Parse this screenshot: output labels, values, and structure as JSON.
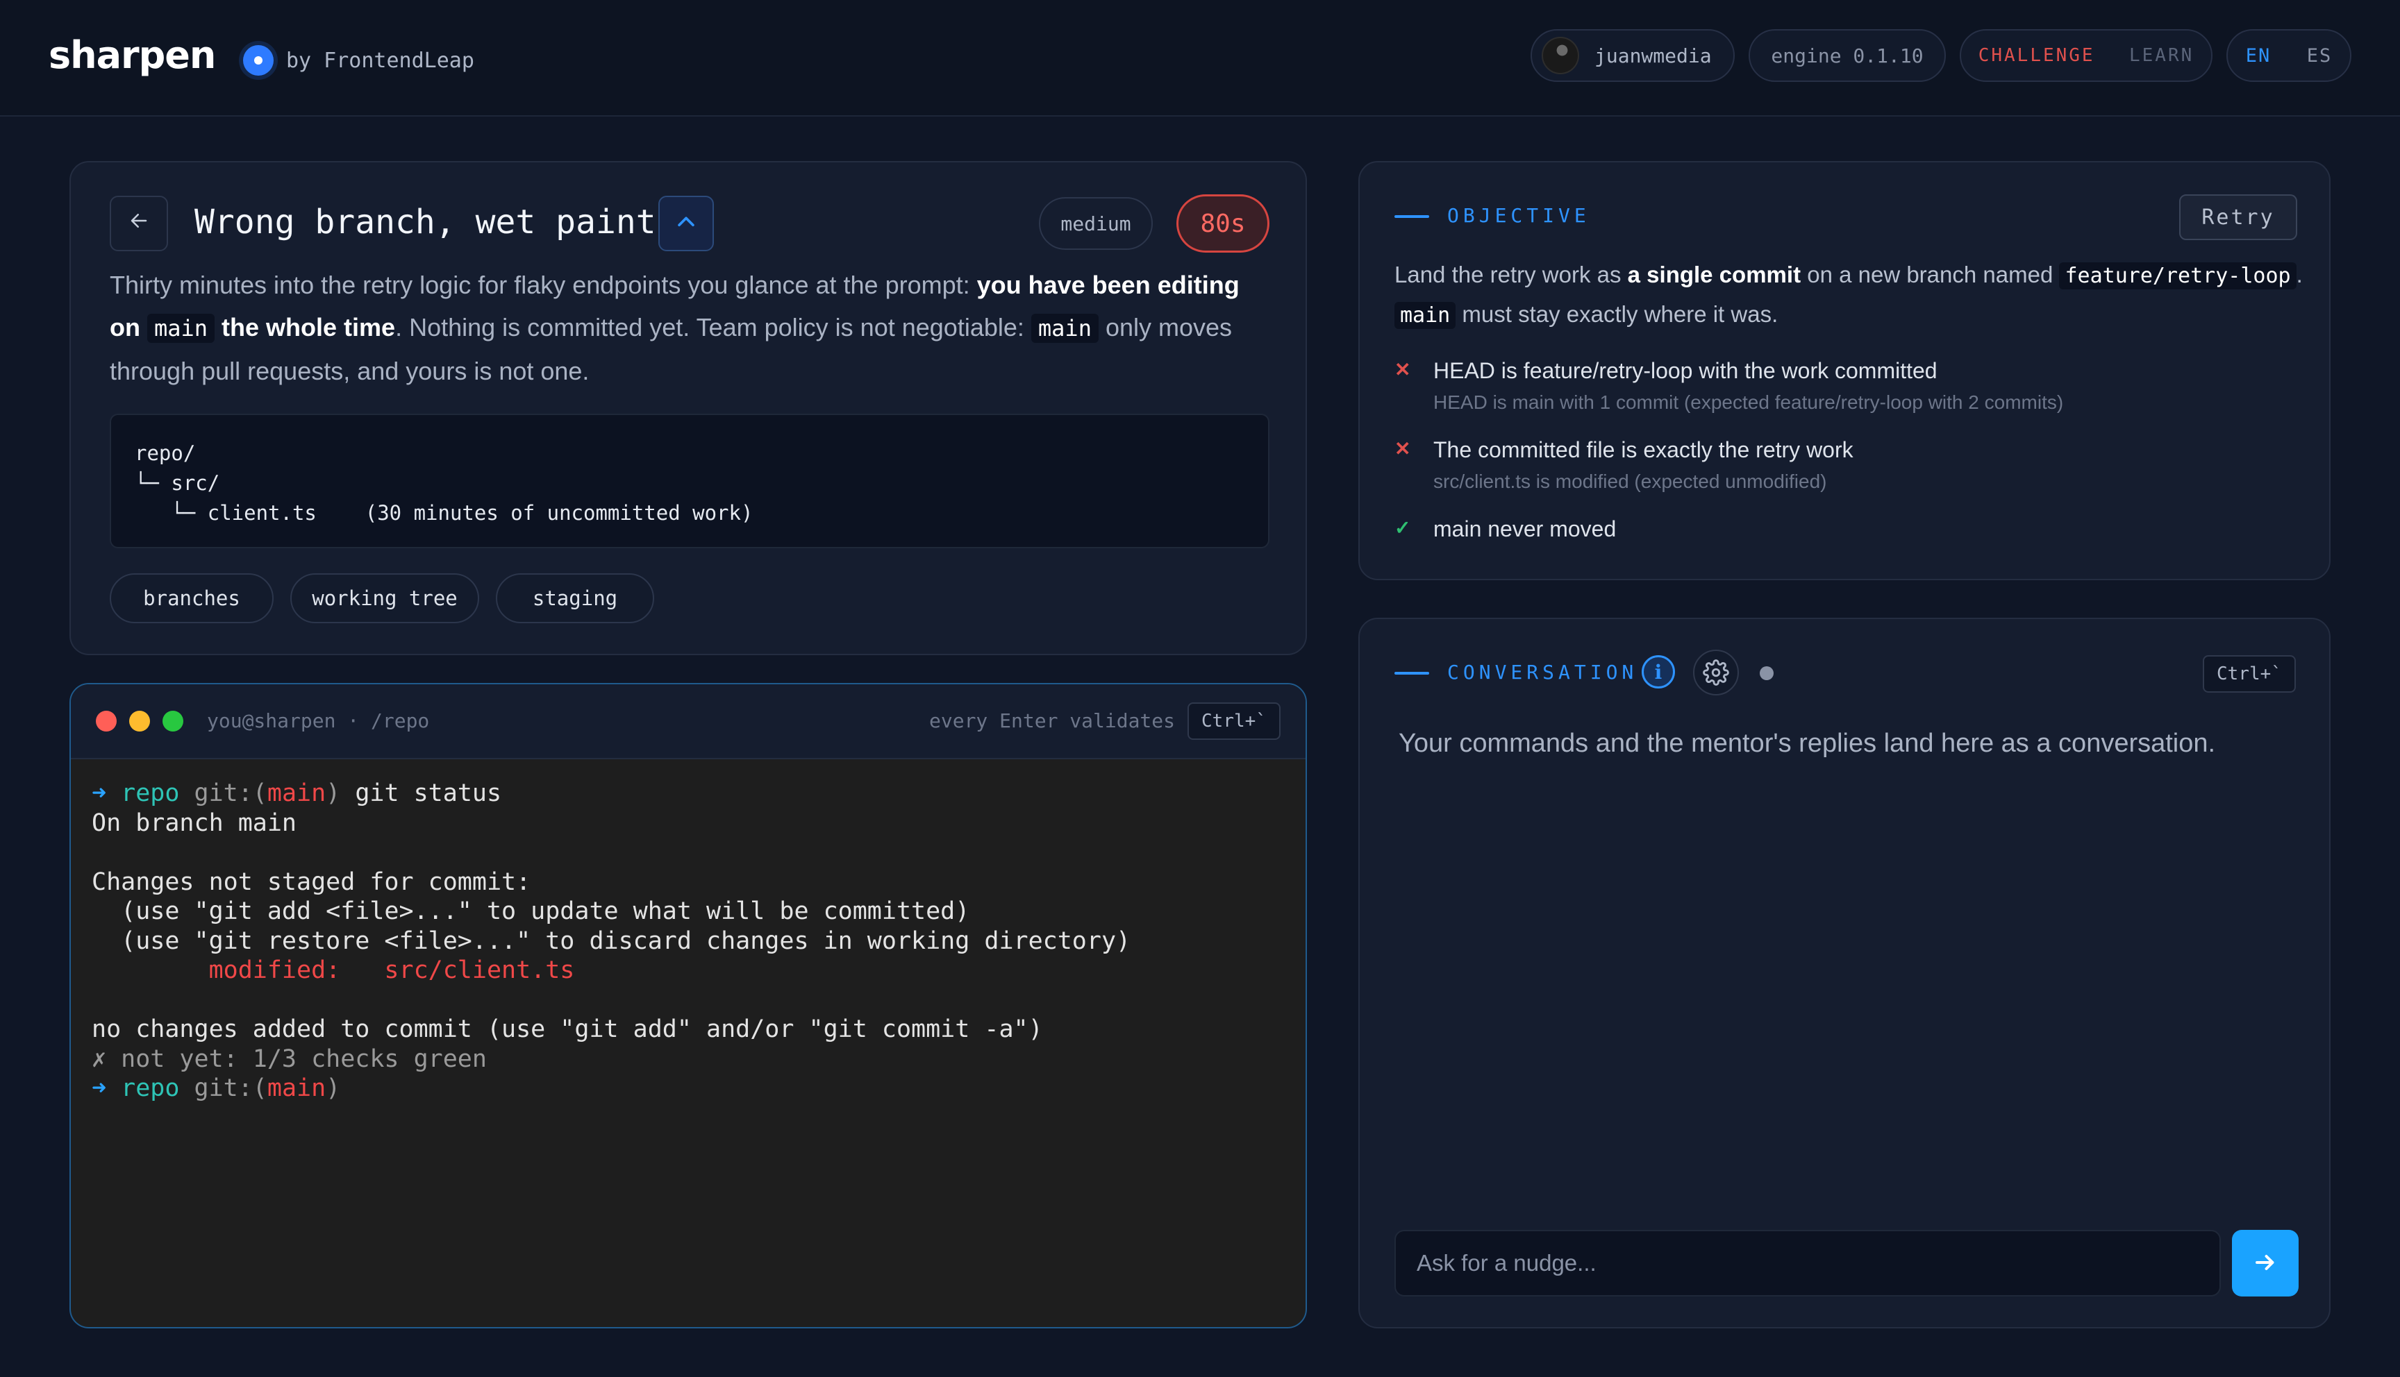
{
  "header": {
    "logo": "sharpen",
    "by": "by FrontendLeap",
    "username": "juanwmedia",
    "engine": "engine 0.1.10",
    "modes": [
      "CHALLENGE",
      "LEARN"
    ],
    "languages": [
      "EN",
      "ES"
    ]
  },
  "challenge": {
    "title": "Wrong branch, wet paint",
    "difficulty": "medium",
    "timer": "80s",
    "description": [
      {
        "t": "text",
        "v": "Thirty minutes into the retry logic for flaky endpoints you glance at the prompt: "
      },
      {
        "t": "bold",
        "v": "you have been editing on "
      },
      {
        "t": "code",
        "v": "main"
      },
      {
        "t": "bold",
        "v": " the whole time"
      },
      {
        "t": "text",
        "v": ". Nothing is committed yet. Team policy is not negotiable: "
      },
      {
        "t": "code",
        "v": "main"
      },
      {
        "t": "text",
        "v": " only moves through pull requests, and yours is not one."
      }
    ],
    "tree": [
      "repo/",
      "└─ src/",
      "   └─ client.ts    (30 minutes of uncommitted work)"
    ],
    "tags": [
      "branches",
      "working tree",
      "staging"
    ]
  },
  "terminal": {
    "path": "you@sharpen · /repo",
    "hint": "every Enter validates",
    "shortcut": "Ctrl+`",
    "lines": [
      [
        {
          "c": "t-arrow",
          "v": "➜ "
        },
        {
          "c": "t-repo",
          "v": "repo "
        },
        {
          "c": "t-dim",
          "v": "git:("
        },
        {
          "c": "t-red",
          "v": "main"
        },
        {
          "c": "t-dim",
          "v": ")"
        },
        {
          "c": "",
          "v": " git status"
        }
      ],
      [
        {
          "c": "",
          "v": "On branch main"
        }
      ],
      [
        {
          "c": "",
          "v": " "
        }
      ],
      [
        {
          "c": "",
          "v": "Changes not staged for commit:"
        }
      ],
      [
        {
          "c": "",
          "v": "  (use \"git add <file>...\" to update what will be committed)"
        }
      ],
      [
        {
          "c": "",
          "v": "  (use \"git restore <file>...\" to discard changes in working directory)"
        }
      ],
      [
        {
          "c": "t-red",
          "v": "        modified:   src/client.ts"
        }
      ],
      [
        {
          "c": "",
          "v": " "
        }
      ],
      [
        {
          "c": "",
          "v": "no changes added to commit (use \"git add\" and/or \"git commit -a\")"
        }
      ],
      [
        {
          "c": "t-dim",
          "v": "✗ not yet: 1/3 checks green"
        }
      ],
      [
        {
          "c": "t-arrow",
          "v": "➜ "
        },
        {
          "c": "t-repo",
          "v": "repo "
        },
        {
          "c": "t-dim",
          "v": "git:("
        },
        {
          "c": "t-red",
          "v": "main"
        },
        {
          "c": "t-dim",
          "v": ")"
        }
      ]
    ]
  },
  "objective": {
    "label": "OBJECTIVE",
    "retry": "Retry",
    "goal": [
      {
        "t": "text",
        "v": "Land the retry work as "
      },
      {
        "t": "bold",
        "v": "a single commit"
      },
      {
        "t": "text",
        "v": " on a new branch named "
      },
      {
        "t": "code",
        "v": "feature/retry-loop"
      },
      {
        "t": "text",
        "v": ". "
      },
      {
        "t": "code",
        "v": "main"
      },
      {
        "t": "text",
        "v": " must stay exactly where it was."
      }
    ],
    "checks": [
      {
        "status": "fail",
        "mark": "✕",
        "title": "HEAD is feature/retry-loop with the work committed",
        "detail": "HEAD is main with 1 commit (expected feature/retry-loop with 2 commits)"
      },
      {
        "status": "fail",
        "mark": "✕",
        "title": "The committed file is exactly the retry work",
        "detail": "src/client.ts is modified (expected unmodified)"
      },
      {
        "status": "pass",
        "mark": "✓",
        "title": "main never moved",
        "detail": ""
      }
    ]
  },
  "conversation": {
    "label": "CONVERSATION",
    "shortcut": "Ctrl+`",
    "placeholder_text": "Your commands and the mentor's replies land here as a conversation.",
    "input_placeholder": "Ask for a nudge..."
  },
  "colors": {
    "accent": "#2e93ff",
    "danger": "#e0514d",
    "success": "#2fbf71",
    "background": "#0f1626"
  }
}
